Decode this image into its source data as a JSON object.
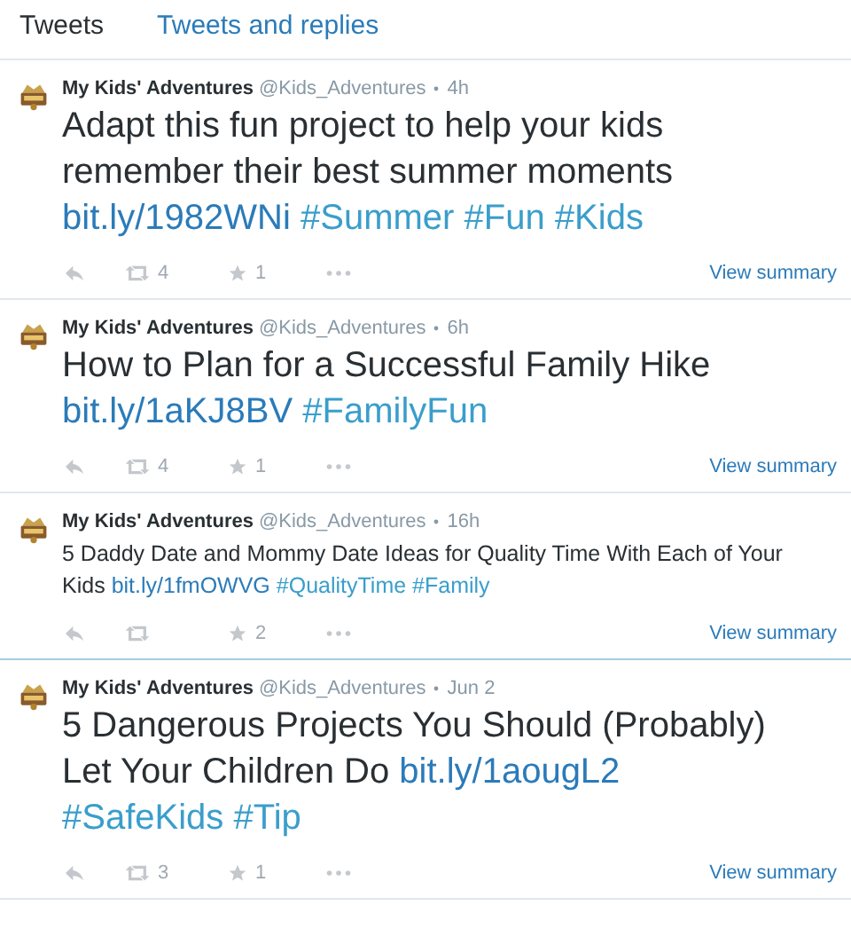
{
  "tabs": [
    {
      "label": "Tweets",
      "selected": true
    },
    {
      "label": "Tweets and replies",
      "selected": false
    }
  ],
  "tweets": [
    {
      "author": "My Kids' Adventures",
      "handle": "@Kids_Adventures",
      "time": "4h",
      "kind": "large",
      "text": "Adapt this fun project to help your kids remember their best summer moments",
      "link": "bit.ly/1982WNi",
      "hashtags": [
        "#Summer",
        "#Fun",
        "#Kids"
      ],
      "retweets": "4",
      "favorites": "1",
      "action": "View summary"
    },
    {
      "author": "My Kids' Adventures",
      "handle": "@Kids_Adventures",
      "time": "6h",
      "kind": "large",
      "text": "How to Plan for a Successful Family Hike",
      "link": "bit.ly/1aKJ8BV",
      "hashtags": [
        "#FamilyFun"
      ],
      "retweets": "4",
      "favorites": "1",
      "action": "View summary"
    },
    {
      "author": "My Kids' Adventures",
      "handle": "@Kids_Adventures",
      "time": "16h",
      "kind": "small",
      "text": "5 Daddy Date and Mommy Date Ideas for Quality Time With Each of Your Kids",
      "link": "bit.ly/1fmOWVG",
      "hashtags": [
        "#QualityTime",
        "#Family"
      ],
      "favorites": "2",
      "action": "View summary"
    },
    {
      "author": "My Kids' Adventures",
      "handle": "@Kids_Adventures",
      "time": "Jun 2",
      "kind": "large",
      "text": "5 Dangerous Projects You Should (Probably) Let Your Children Do",
      "link": "bit.ly/1aougL2",
      "hashtags": [
        "#SafeKids",
        "#Tip"
      ],
      "retweets": "3",
      "favorites": "1",
      "action": "View summary"
    }
  ]
}
